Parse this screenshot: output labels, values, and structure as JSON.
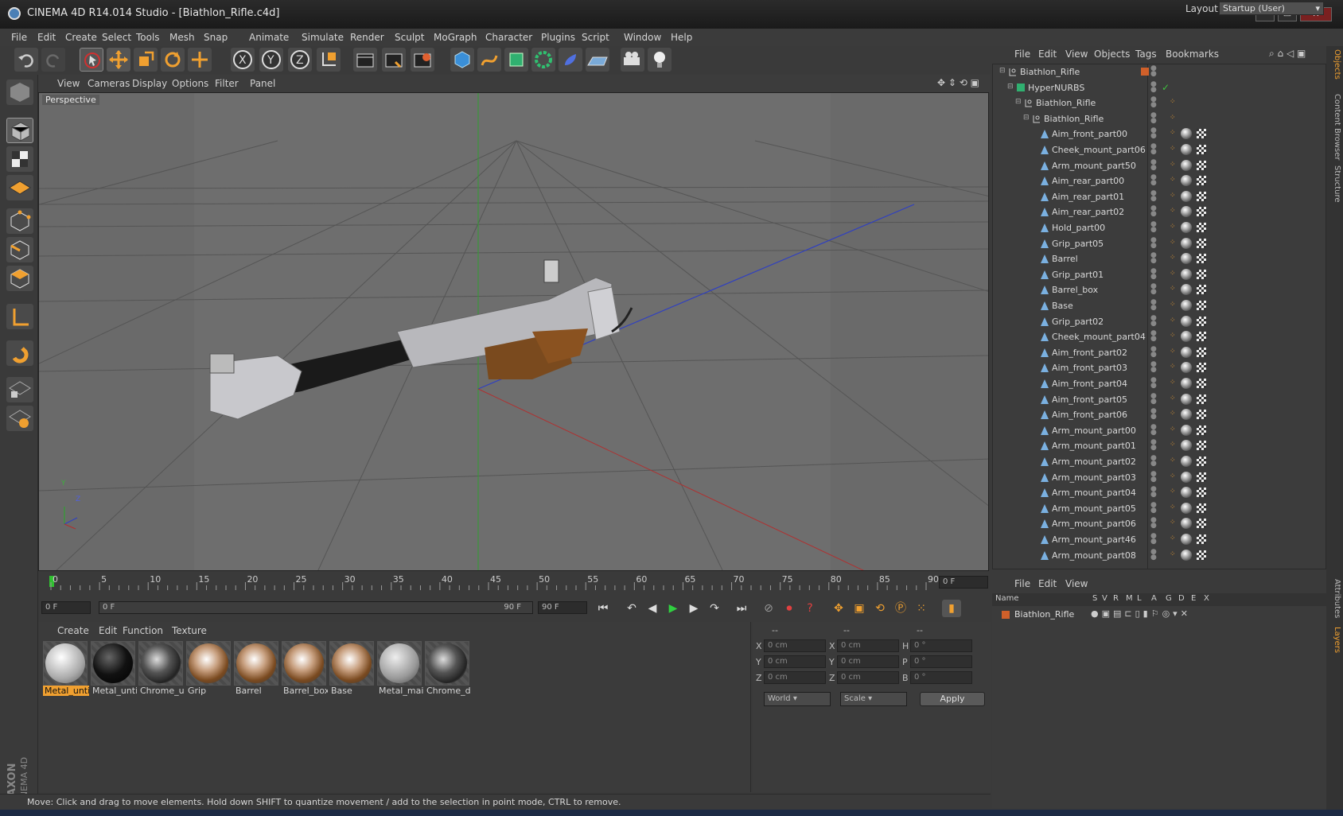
{
  "window": {
    "title": "CINEMA 4D R14.014 Studio - [Biathlon_Rifle.c4d]",
    "min": "—",
    "max": "▭",
    "close": "✕"
  },
  "menubar": [
    "File",
    "Edit",
    "Create",
    "Select",
    "Tools",
    "Mesh",
    "Snap",
    "Animate",
    "Simulate",
    "Render",
    "Sculpt",
    "MoGraph",
    "Character",
    "Plugins",
    "Script",
    "Window",
    "Help"
  ],
  "layout": {
    "label": "Layout:",
    "value": "Startup (User)"
  },
  "viewport": {
    "menu": [
      "View",
      "Cameras",
      "Display",
      "Options",
      "Filter",
      "Panel"
    ],
    "label": "Perspective",
    "axis_y": "Y",
    "axis_z": "Z"
  },
  "timeline": {
    "ticks": [
      "0",
      "5",
      "10",
      "15",
      "20",
      "25",
      "30",
      "35",
      "40",
      "45",
      "50",
      "55",
      "60",
      "65",
      "70",
      "75",
      "80",
      "85",
      "90"
    ],
    "current_frame": "0 F",
    "start_field": "0 F",
    "range_start": "0 F",
    "range_end": "90 F",
    "end_field": "90 F"
  },
  "materials": {
    "menu": [
      "Create",
      "Edit",
      "Function",
      "Texture"
    ],
    "items": [
      {
        "label": "Metal_unti",
        "style": "white",
        "selected": true
      },
      {
        "label": "Metal_unti",
        "style": "black",
        "selected": false
      },
      {
        "label": "Chrome_ur",
        "style": "chrome",
        "selected": false
      },
      {
        "label": "Grip",
        "style": "wood",
        "selected": false
      },
      {
        "label": "Barrel",
        "style": "wood",
        "selected": false
      },
      {
        "label": "Barrel_box",
        "style": "wood",
        "selected": false
      },
      {
        "label": "Base",
        "style": "wood",
        "selected": false
      },
      {
        "label": "Metal_mair",
        "style": "speckle",
        "selected": false
      },
      {
        "label": "Chrome_da",
        "style": "chrome",
        "selected": false
      }
    ]
  },
  "coords": {
    "headers": [
      "--",
      "--",
      "--"
    ],
    "rows": [
      {
        "a": "X",
        "av": "0 cm",
        "b": "X",
        "bv": "0 cm",
        "c": "H",
        "cv": "0 °"
      },
      {
        "a": "Y",
        "av": "0 cm",
        "b": "Y",
        "bv": "0 cm",
        "c": "P",
        "cv": "0 °"
      },
      {
        "a": "Z",
        "av": "0 cm",
        "b": "Z",
        "bv": "0 cm",
        "c": "B",
        "cv": "0 °"
      }
    ],
    "mode1": "World",
    "mode2": "Scale",
    "apply": "Apply"
  },
  "status": "Move: Click and drag to move elements. Hold down SHIFT to quantize movement / add to the selection in point mode, CTRL to remove.",
  "object_manager": {
    "menu": [
      "File",
      "Edit",
      "View",
      "Objects",
      "Tags",
      "Bookmarks"
    ],
    "objects": [
      {
        "name": "Biathlon_Rifle",
        "indent": 0,
        "type": "null"
      },
      {
        "name": "HyperNURBS",
        "indent": 1,
        "type": "nurbs"
      },
      {
        "name": "Biathlon_Rifle",
        "indent": 2,
        "type": "null"
      },
      {
        "name": "Biathlon_Rifle",
        "indent": 3,
        "type": "null"
      },
      {
        "name": "Aim_front_part00",
        "indent": 4,
        "type": "poly"
      },
      {
        "name": "Cheek_mount_part06",
        "indent": 4,
        "type": "poly"
      },
      {
        "name": "Arm_mount_part50",
        "indent": 4,
        "type": "poly"
      },
      {
        "name": "Aim_rear_part00",
        "indent": 4,
        "type": "poly"
      },
      {
        "name": "Aim_rear_part01",
        "indent": 4,
        "type": "poly"
      },
      {
        "name": "Aim_rear_part02",
        "indent": 4,
        "type": "poly"
      },
      {
        "name": "Hold_part00",
        "indent": 4,
        "type": "poly"
      },
      {
        "name": "Grip_part05",
        "indent": 4,
        "type": "poly"
      },
      {
        "name": "Barrel",
        "indent": 4,
        "type": "poly"
      },
      {
        "name": "Grip_part01",
        "indent": 4,
        "type": "poly"
      },
      {
        "name": "Barrel_box",
        "indent": 4,
        "type": "poly"
      },
      {
        "name": "Base",
        "indent": 4,
        "type": "poly"
      },
      {
        "name": "Grip_part02",
        "indent": 4,
        "type": "poly"
      },
      {
        "name": "Cheek_mount_part04",
        "indent": 4,
        "type": "poly"
      },
      {
        "name": "Aim_front_part02",
        "indent": 4,
        "type": "poly"
      },
      {
        "name": "Aim_front_part03",
        "indent": 4,
        "type": "poly"
      },
      {
        "name": "Aim_front_part04",
        "indent": 4,
        "type": "poly"
      },
      {
        "name": "Aim_front_part05",
        "indent": 4,
        "type": "poly"
      },
      {
        "name": "Aim_front_part06",
        "indent": 4,
        "type": "poly"
      },
      {
        "name": "Arm_mount_part00",
        "indent": 4,
        "type": "poly"
      },
      {
        "name": "Arm_mount_part01",
        "indent": 4,
        "type": "poly"
      },
      {
        "name": "Arm_mount_part02",
        "indent": 4,
        "type": "poly"
      },
      {
        "name": "Arm_mount_part03",
        "indent": 4,
        "type": "poly"
      },
      {
        "name": "Arm_mount_part04",
        "indent": 4,
        "type": "poly"
      },
      {
        "name": "Arm_mount_part05",
        "indent": 4,
        "type": "poly"
      },
      {
        "name": "Arm_mount_part06",
        "indent": 4,
        "type": "poly"
      },
      {
        "name": "Arm_mount_part46",
        "indent": 4,
        "type": "poly"
      },
      {
        "name": "Arm_mount_part08",
        "indent": 4,
        "type": "poly"
      }
    ]
  },
  "layer_manager": {
    "menu": [
      "File",
      "Edit",
      "View"
    ],
    "columns": [
      "Name",
      "S",
      "V",
      "R",
      "M",
      "L",
      "A",
      "G",
      "D",
      "E",
      "X"
    ],
    "layers": [
      {
        "name": "Biathlon_Rifle",
        "color": "#d0602a"
      }
    ]
  },
  "right_tabs": [
    "Objects",
    "Content Browser",
    "Structure",
    "Attributes",
    "Layers"
  ],
  "brand": {
    "line1": "MAXON",
    "line2": "CINEMA 4D"
  },
  "colors": {
    "accent_orange": "#f0a030",
    "axis_green": "#40b040",
    "axis_blue": "#3040c0",
    "axis_red": "#c03030",
    "viewport_bg": "#6a6a6a"
  }
}
